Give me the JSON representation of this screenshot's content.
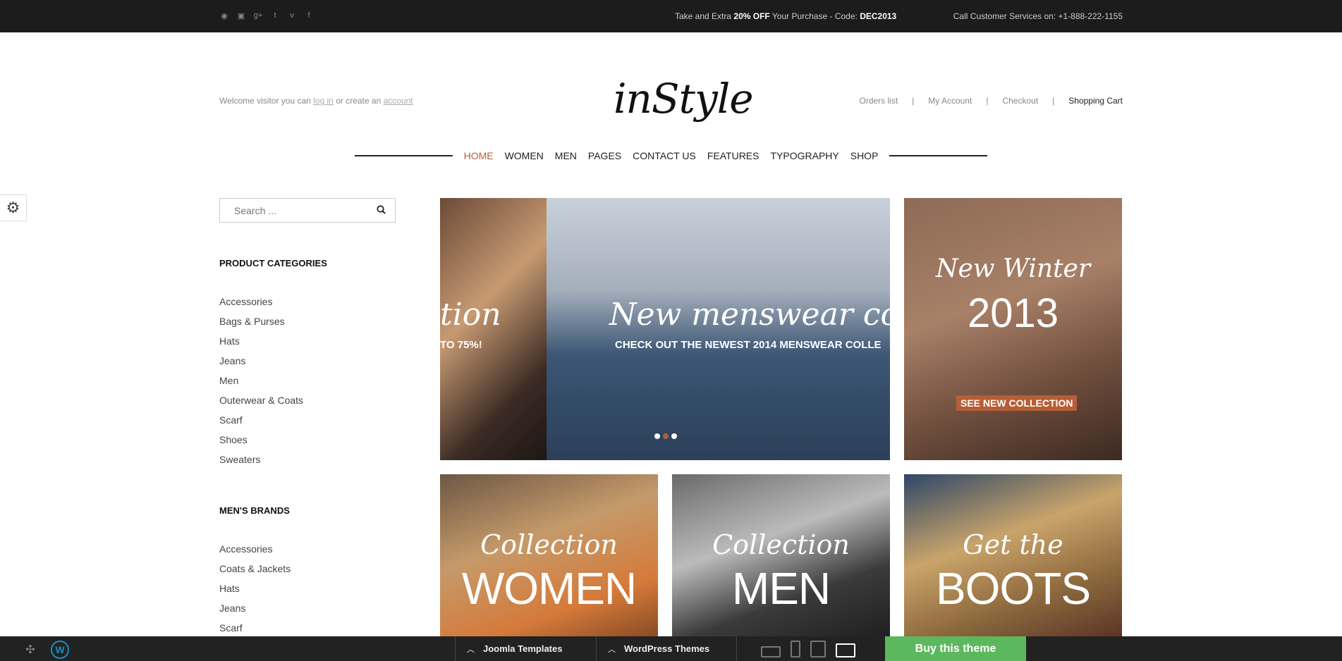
{
  "topbar": {
    "social_icons": [
      "rss-icon",
      "flickr-icon",
      "googleplus-icon",
      "twitter-icon",
      "vimeo-icon",
      "facebook-icon"
    ],
    "promo_pre": "Take and Extra",
    "promo_bold": "20% OFF",
    "promo_mid": "Your Purchase - Code:",
    "promo_code": "DEC2013",
    "call": "Call Customer Services on: +1-888-222-1155"
  },
  "header": {
    "welcome_pre": "Welcome visitor you can",
    "login": "log in",
    "welcome_mid": "or create an",
    "account": "account",
    "logo": "inStyle",
    "links": [
      "Orders list",
      "My Account",
      "Checkout",
      "Shopping Cart"
    ],
    "sep": "|"
  },
  "nav": {
    "items": [
      "HOME",
      "WOMEN",
      "MEN",
      "PAGES",
      "CONTACT US",
      "FEATURES",
      "TYPOGRAPHY",
      "SHOP"
    ],
    "active": "HOME"
  },
  "sidebar": {
    "search_placeholder": "Search ...",
    "categories_title": "PRODUCT CATEGORIES",
    "categories": [
      "Accessories",
      "Bags & Purses",
      "Hats",
      "Jeans",
      "Men",
      "Outerwear & Coats",
      "Scarf",
      "Shoes",
      "Sweaters"
    ],
    "brands_title": "MEN'S BRANDS",
    "brands": [
      "Accessories",
      "Coats & Jackets",
      "Hats",
      "Jeans",
      "Scarf"
    ]
  },
  "slider": {
    "left_title": "tion",
    "left_sub": "TO 75%!",
    "title": "New menswear collec",
    "sub": "CHECK OUT THE NEWEST 2014 MENSWEAR COLLE",
    "active_dot": 2
  },
  "winter": {
    "script": "New Winter",
    "year": "2013",
    "cta": "SEE NEW COLLECTION"
  },
  "tiles": [
    {
      "script": "Collection",
      "big": "WOMEN"
    },
    {
      "script": "Collection",
      "big": "MEN"
    },
    {
      "script": "Get the",
      "big": "BOOTS"
    }
  ],
  "bottombar": {
    "joomla": "Joomla Templates",
    "wordpress": "WordPress Themes",
    "buy": "Buy this theme"
  },
  "colors": {
    "accent": "#b65e36",
    "buy": "#5cb85c",
    "topbar": "#1c1c1c"
  }
}
